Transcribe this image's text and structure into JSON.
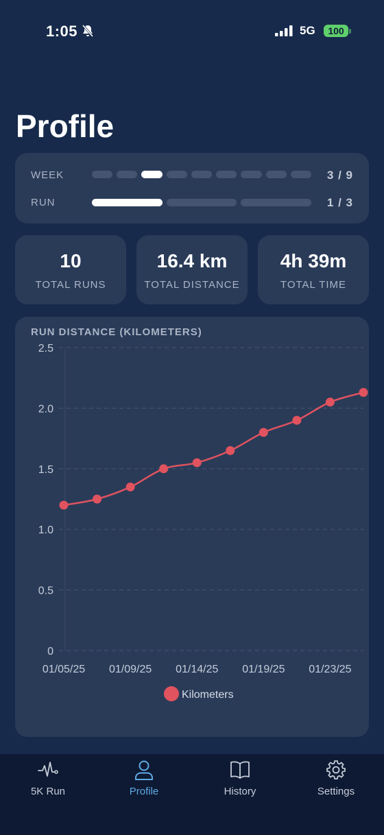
{
  "status_bar": {
    "time": "1:05",
    "network": "5G",
    "battery": "100"
  },
  "page": {
    "title": "Profile"
  },
  "progress": {
    "week": {
      "label": "WEEK",
      "count": "3 / 9",
      "total": 9,
      "current": 3
    },
    "run": {
      "label": "RUN",
      "count": "1 / 3",
      "total": 3,
      "current": 1
    }
  },
  "stats": [
    {
      "value": "10",
      "label": "TOTAL RUNS"
    },
    {
      "value": "16.4 km",
      "label": "TOTAL DISTANCE"
    },
    {
      "value": "4h 39m",
      "label": "TOTAL TIME"
    }
  ],
  "chart_data": {
    "type": "line",
    "title": "RUN DISTANCE (KILOMETERS)",
    "x_tick_labels": [
      "01/05/25",
      "01/09/25",
      "01/14/25",
      "01/19/25",
      "01/23/25"
    ],
    "y_ticks": [
      "0",
      "0.5",
      "1.0",
      "1.5",
      "2.0",
      "2.5"
    ],
    "ylim": [
      0,
      2.5
    ],
    "grid": true,
    "legend_position": "bottom-center",
    "series": [
      {
        "name": "Kilometers",
        "color": "#e0535f",
        "values": [
          1.2,
          1.25,
          1.35,
          1.5,
          1.55,
          1.65,
          1.8,
          1.9,
          2.05,
          2.13
        ]
      }
    ]
  },
  "tabs": [
    {
      "label": "5K Run",
      "icon": "pulse-icon",
      "active": false
    },
    {
      "label": "Profile",
      "icon": "person-icon",
      "active": true
    },
    {
      "label": "History",
      "icon": "book-icon",
      "active": false
    },
    {
      "label": "Settings",
      "icon": "gear-icon",
      "active": false
    }
  ],
  "colors": {
    "background": "#172a4b",
    "card": "#2a3b58",
    "accent": "#5fa9e6",
    "line": "#e0535f"
  }
}
